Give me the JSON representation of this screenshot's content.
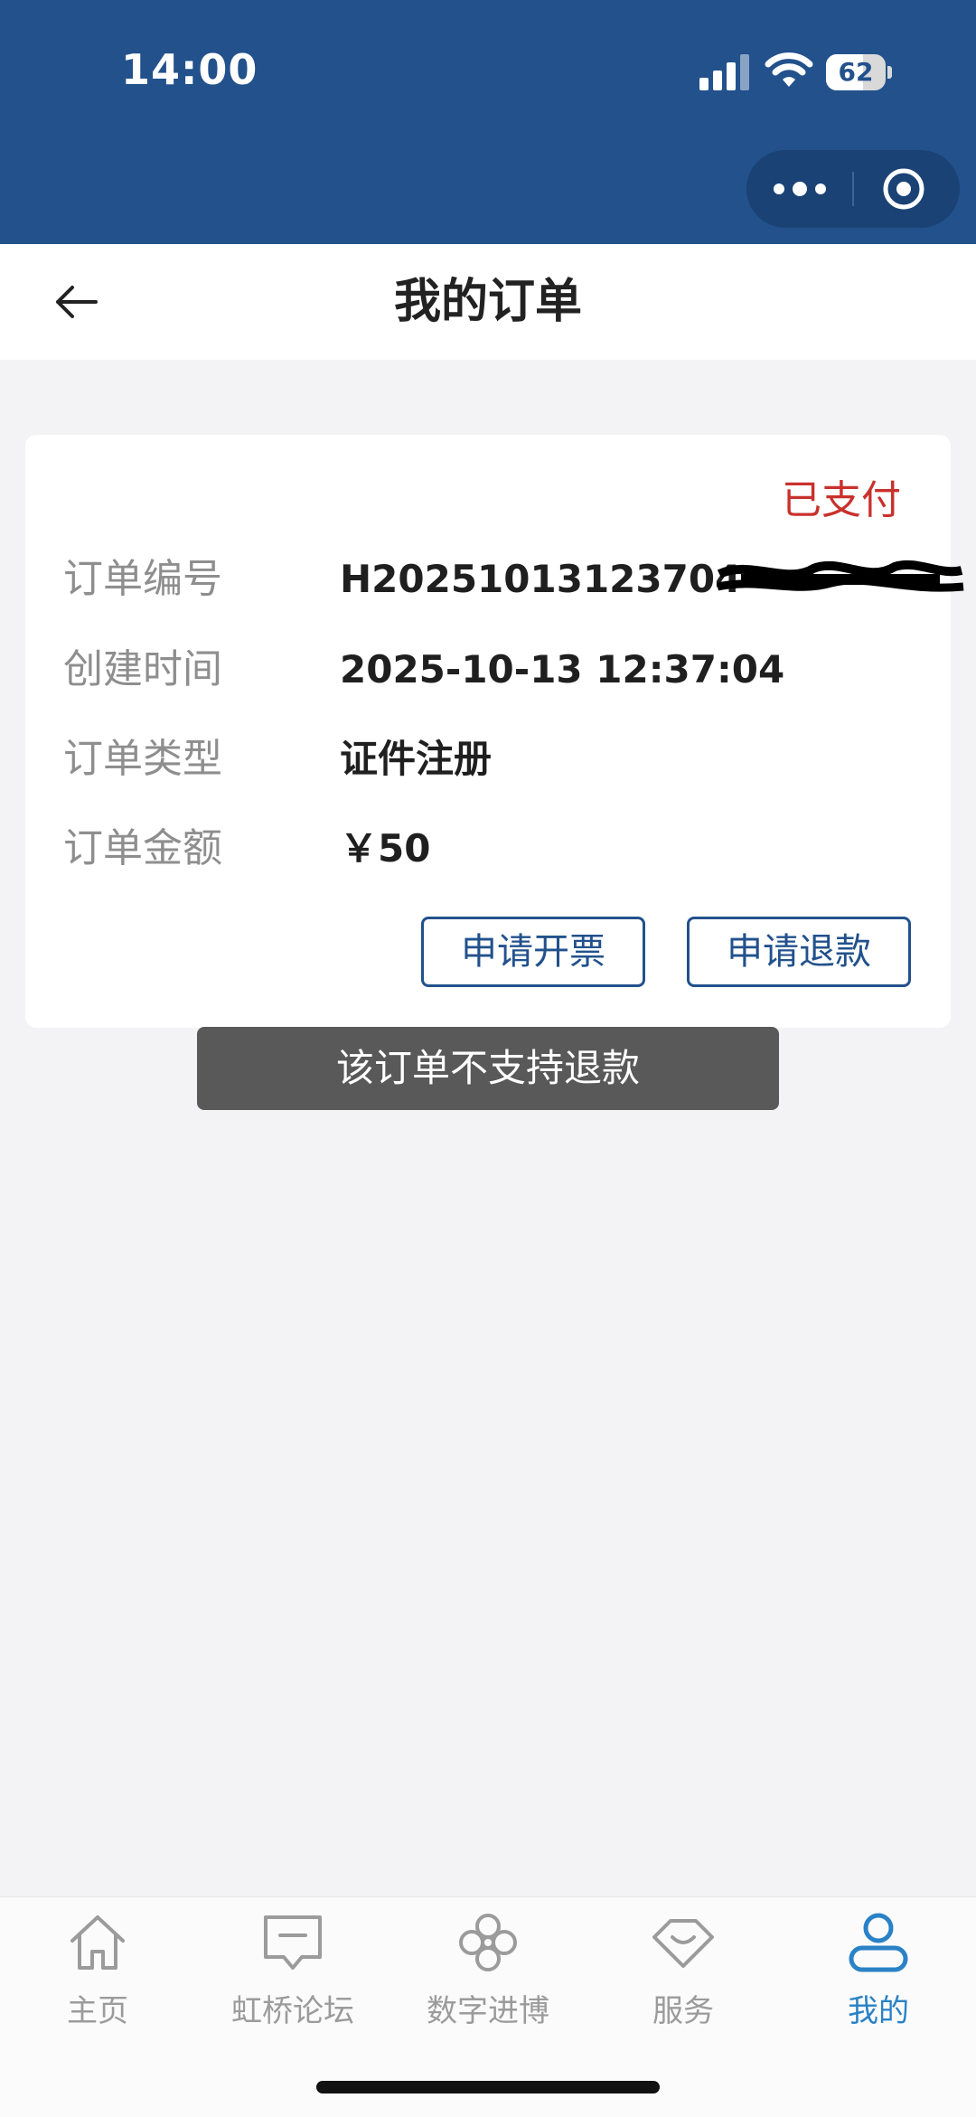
{
  "status_bar": {
    "time": "14:00",
    "battery": "62",
    "battery_level": 0.62
  },
  "header": {
    "title": "我的订单"
  },
  "order": {
    "status": "已支付",
    "fields": [
      {
        "label": "订单编号",
        "value": "H20251013123704"
      },
      {
        "label": "创建时间",
        "value": "2025-10-13 12:37:04"
      },
      {
        "label": "订单类型",
        "value": "证件注册"
      },
      {
        "label": "订单金额",
        "value": "￥50"
      }
    ],
    "buttons": {
      "invoice": "申请开票",
      "refund": "申请退款"
    }
  },
  "toast": "该订单不支持退款",
  "tabs": [
    {
      "label": "主页",
      "icon": "home-icon"
    },
    {
      "label": "虹桥论坛",
      "icon": "forum-icon"
    },
    {
      "label": "数字进博",
      "icon": "clover-icon"
    },
    {
      "label": "服务",
      "icon": "diamond-icon"
    },
    {
      "label": "我的",
      "icon": "user-icon",
      "active": true
    }
  ],
  "colors": {
    "header": "#22518c",
    "status_paid": "#c9312c",
    "accent": "#2a82c6"
  }
}
